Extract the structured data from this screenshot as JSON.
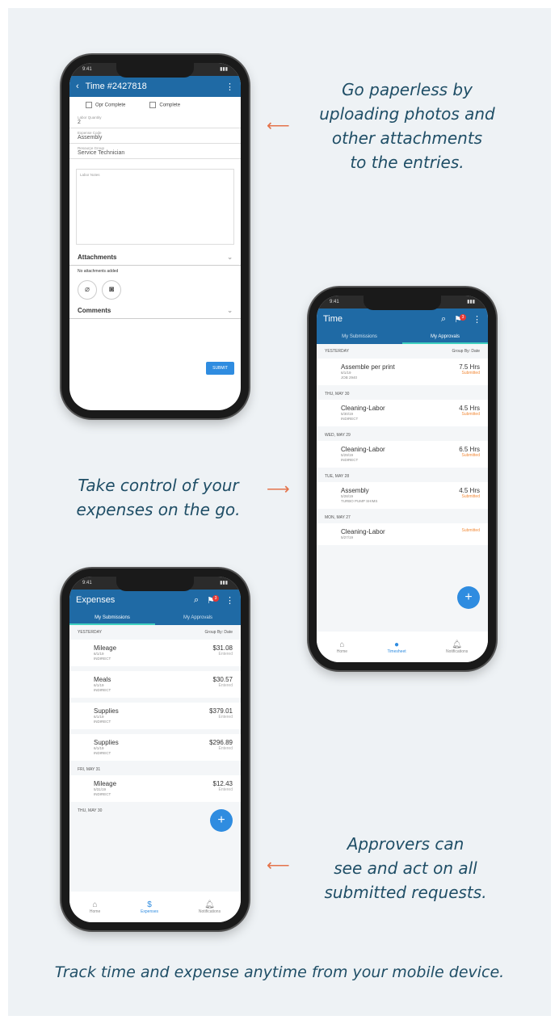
{
  "captions": {
    "top_right": [
      "Go paperless by",
      "uploading photos and",
      "other attachments",
      "to the entries."
    ],
    "middle_left": [
      "Take control of your",
      "expenses on the go."
    ],
    "bottom_right": [
      "Approvers can",
      "see and act on all",
      "submitted requests."
    ],
    "footer": "Track time and expense anytime from your mobile device."
  },
  "phone1": {
    "title": "Time #2427818",
    "checks": [
      "Opr Complete",
      "Complete"
    ],
    "fields": [
      {
        "label": "Labor Quantity",
        "value": "2"
      },
      {
        "label": "Expense Code",
        "value": "Assembly"
      },
      {
        "label": "Resource Group",
        "value": "Service Technician"
      }
    ],
    "notes_label": "Labor Notes",
    "attachments_label": "Attachments",
    "no_attachments": "No attachments added",
    "comments_label": "Comments",
    "submit": "SUBMIT"
  },
  "phone2": {
    "title": "Time",
    "badge": "3",
    "tabs": [
      "My Submissions",
      "My Approvals"
    ],
    "list_head": "YESTERDAY",
    "group_by": "Group By: Date",
    "entries": [
      {
        "name": "Assemble per print",
        "line1": "6/1/19",
        "line2": "JOB 2940",
        "amount": "7.5 Hrs",
        "status": "Submitted",
        "day_after": "THU, MAY 30"
      },
      {
        "name": "Cleaning-Labor",
        "line1": "5/30/19",
        "line2": "INDIRECT",
        "amount": "4.5 Hrs",
        "status": "Submitted",
        "day_after": "WED, MAY 29"
      },
      {
        "name": "Cleaning-Labor",
        "line1": "5/29/19",
        "line2": "INDIRECT",
        "amount": "6.5 Hrs",
        "status": "Submitted",
        "day_after": "TUE, MAY 28"
      },
      {
        "name": "Assembly",
        "line1": "5/28/19",
        "line2": "TURBO PUMP SHIMS",
        "amount": "4.5 Hrs",
        "status": "Submitted",
        "day_after": "MON, MAY 27"
      },
      {
        "name": "Cleaning-Labor",
        "line1": "5/27/19",
        "line2": "",
        "amount": "",
        "status": "Submitted",
        "day_after": ""
      }
    ],
    "nav": [
      "Home",
      "Timesheet",
      "Notifications"
    ]
  },
  "phone3": {
    "title": "Expenses",
    "badge": "3",
    "tabs": [
      "My Submissions",
      "My Approvals"
    ],
    "list_head": "YESTERDAY",
    "group_by": "Group By: Date",
    "entries": [
      {
        "name": "Mileage",
        "line1": "6/1/19",
        "line2": "INDIRECT",
        "amount": "$31.08",
        "status": "Entered",
        "day_after": ""
      },
      {
        "name": "Meals",
        "line1": "6/1/19",
        "line2": "INDIRECT",
        "amount": "$30.57",
        "status": "Entered",
        "day_after": ""
      },
      {
        "name": "Supplies",
        "line1": "6/1/19",
        "line2": "INDIRECT",
        "amount": "$379.01",
        "status": "Entered",
        "day_after": ""
      },
      {
        "name": "Supplies",
        "line1": "6/1/19",
        "line2": "INDIRECT",
        "amount": "$296.89",
        "status": "Entered",
        "day_after": "FRI, MAY 31"
      },
      {
        "name": "Mileage",
        "line1": "5/31/19",
        "line2": "INDIRECT",
        "amount": "$12.43",
        "status": "Entered",
        "day_after": "THU, MAY 30"
      }
    ],
    "nav": [
      "Home",
      "Expenses",
      "Notifications"
    ]
  },
  "colors": {
    "brand_blue": "#1f6aa5",
    "fab_blue": "#2f8ce0",
    "caption_teal": "#1f4e66",
    "arrow_orange": "#e4734a"
  },
  "icons": {
    "back": "back-arrow-icon",
    "more": "more-vert-icon",
    "search": "search-icon",
    "flag": "flag-icon",
    "plus": "plus-icon",
    "home": "home-icon",
    "bell": "bell-icon",
    "dollar": "dollar-icon",
    "clock": "clock-icon",
    "paperclip": "paperclip-icon",
    "camera": "camera-icon"
  }
}
